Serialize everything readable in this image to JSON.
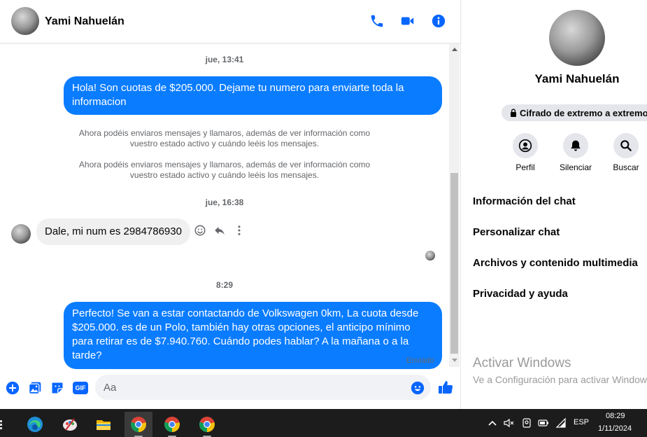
{
  "header": {
    "contact_name": "Yami Nahuelán"
  },
  "messages": {
    "time1": "jue, 13:41",
    "out1": "Hola! Son cuotas de $205.000. Dejame tu numero para enviarte toda la informacion",
    "note1": "Ahora podéis enviaros mensajes y llamaros, además de ver información como vuestro estado activo y cuándo leéis los mensajes.",
    "note2": "Ahora podéis enviaros mensajes y llamaros, además de ver información como vuestro estado activo y cuándo leéis los mensajes.",
    "time2": "jue, 16:38",
    "in1": "Dale, mi num es 2984786930",
    "time3": "8:29",
    "out2": "Perfecto!  Se van a estar contactando de Volkswagen 0km, La cuota desde $205.000. es de un Polo, también hay otras opciones, el anticipo mínimo para retirar es de $7.940.760. Cuándo podes hablar? A la mañana o a la tarde?",
    "status": "Enviado"
  },
  "composer": {
    "placeholder": "Aa",
    "gif_label": "GIF"
  },
  "info": {
    "name": "Yami Nahuelán",
    "encryption": "Cifrado de extremo a extremo",
    "actions": {
      "profile": "Perfil",
      "mute": "Silenciar",
      "search": "Buscar"
    },
    "items": [
      "Información del chat",
      "Personalizar chat",
      "Archivos y contenido multimedia",
      "Privacidad y ayuda"
    ]
  },
  "watermark": {
    "title": "Activar Windows",
    "subtitle": "Ve a Configuración para activar Windows."
  },
  "taskbar": {
    "language": "ESP",
    "time": "08:29",
    "date": "1/11/2024"
  },
  "colors": {
    "messenger_blue": "#0a7cff",
    "icon_blue": "#0866ff",
    "taskbar_bg": "#1c1c1c"
  }
}
